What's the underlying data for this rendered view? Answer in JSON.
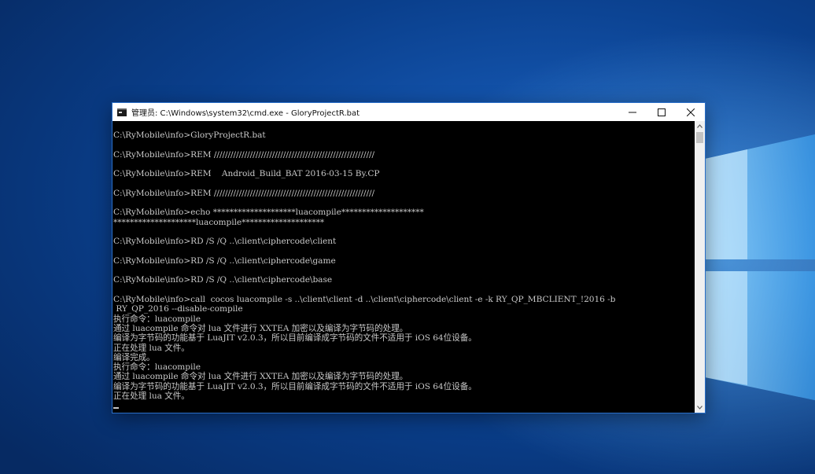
{
  "window": {
    "title": "管理员: C:\\Windows\\system32\\cmd.exe - GloryProjectR.bat",
    "minimize_icon": "minimize-icon",
    "maximize_icon": "maximize-icon",
    "close_icon": "close-icon",
    "app_icon": "console-icon"
  },
  "console": {
    "lines": [
      "C:\\RyMobile\\info>GloryProjectR.bat",
      "",
      "C:\\RyMobile\\info>REM //////////////////////////////////////////////////////////",
      "",
      "C:\\RyMobile\\info>REM    Android_Build_BAT 2016-03-15 By.CP",
      "",
      "C:\\RyMobile\\info>REM //////////////////////////////////////////////////////////",
      "",
      "C:\\RyMobile\\info>echo ********************luacompile********************",
      "********************luacompile********************",
      "",
      "C:\\RyMobile\\info>RD /S /Q ..\\client\\ciphercode\\client",
      "",
      "C:\\RyMobile\\info>RD /S /Q ..\\client\\ciphercode\\game",
      "",
      "C:\\RyMobile\\info>RD /S /Q ..\\client\\ciphercode\\base",
      "",
      "C:\\RyMobile\\info>call  cocos luacompile -s ..\\client\\client -d ..\\client\\ciphercode\\client -e -k RY_QP_MBCLIENT_!2016 -b",
      " RY_QP_2016 --disable-compile",
      "执行命令：luacompile",
      "通过 luacompile 命令对 lua 文件进行 XXTEA 加密以及编译为字节码的处理。",
      "编译为字节码的功能基于 LuaJIT v2.0.3，所以目前编译成字节码的文件不适用于 iOS 64位设备。",
      "正在处理 lua 文件。",
      "编译完成。",
      "执行命令：luacompile",
      "通过 luacompile 命令对 lua 文件进行 XXTEA 加密以及编译为字节码的处理。",
      "编译为字节码的功能基于 LuaJIT v2.0.3，所以目前编译成字节码的文件不适用于 iOS 64位设备。",
      "正在处理 lua 文件。"
    ]
  },
  "scrollbar": {
    "up_icon": "scroll-up-arrow-icon",
    "down_icon": "scroll-down-arrow-icon"
  },
  "colors": {
    "console_bg": "#000000",
    "console_text": "#c8c8c8",
    "titlebar_bg": "#ffffff",
    "desktop_accent": "#1a63c4"
  }
}
